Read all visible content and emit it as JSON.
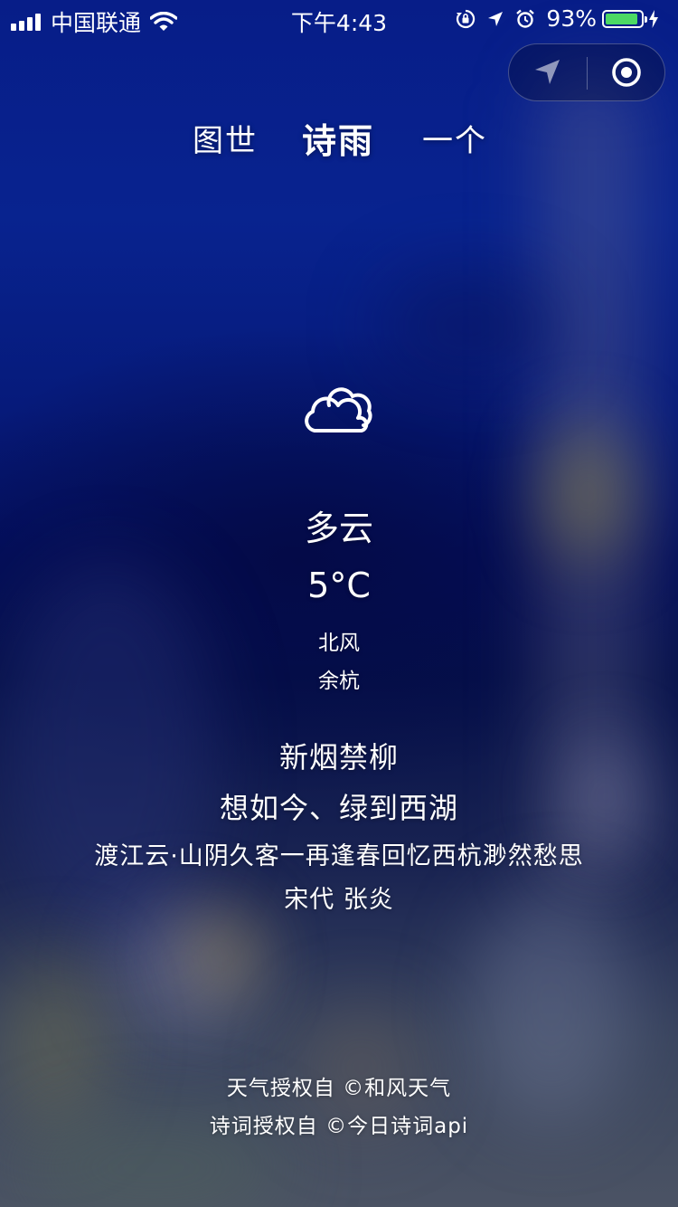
{
  "status_bar": {
    "carrier": "中国联通",
    "time": "下午4:43",
    "battery_percent": "93%",
    "battery_level": 0.93,
    "icons": [
      "signal-icon",
      "wifi-icon",
      "orientation-lock-icon",
      "location-arrow-icon",
      "alarm-icon",
      "battery-icon",
      "charging-icon"
    ]
  },
  "capsule": {
    "icons": [
      "navigation-arrow-icon",
      "close-target-icon"
    ]
  },
  "tabs": [
    {
      "label": "图世",
      "active": false
    },
    {
      "label": "诗雨",
      "active": true
    },
    {
      "label": "一个",
      "active": false
    }
  ],
  "weather": {
    "icon": "cloud-icon",
    "condition": "多云",
    "temperature": "5°C",
    "wind": "北风",
    "city": "余杭"
  },
  "poem": {
    "line1": "新烟禁柳",
    "line2": "想如今、绿到西湖",
    "title": "渡江云·山阴久客一再逢春回忆西杭渺然愁思",
    "author": "宋代 张炎"
  },
  "credits": {
    "weather": "天气授权自 ©和风天气",
    "poetry": "诗词授权自 ©今日诗词api"
  },
  "colors": {
    "background_top": "#071d88",
    "background_bottom": "#4b5364",
    "battery_fill": "#4cd964",
    "text": "#ffffff"
  }
}
